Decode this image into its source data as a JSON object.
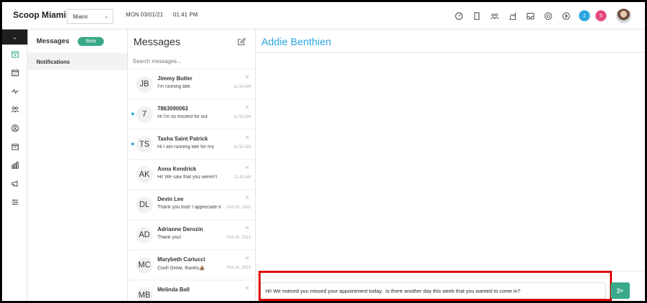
{
  "app": {
    "brand": "Scoop Miami",
    "location": "Miami",
    "date": "MON 03/01/21",
    "time": "01:41 PM"
  },
  "topbar": {
    "icons": [
      "dashboard-icon",
      "door-icon",
      "users-group-icon",
      "chart-icon",
      "inbox-icon",
      "help-icon",
      "play-icon"
    ],
    "badges": [
      {
        "value": "2",
        "color": "#2aa6df"
      },
      {
        "value": "5",
        "color": "#e54b7a"
      }
    ]
  },
  "rail": {
    "icons": [
      "add-calendar-icon",
      "calendar-icon",
      "pulse-icon",
      "users-icon",
      "user-circle-icon",
      "box-icon",
      "bar-chart-icon",
      "megaphone-icon",
      "sliders-icon"
    ]
  },
  "subnav": {
    "title": "Messages",
    "beta": "Beta",
    "items": [
      "Notifications"
    ]
  },
  "conversations": {
    "title": "Messages",
    "search_placeholder": "Search messages...",
    "items": [
      {
        "initials": "JB",
        "name": "Jimmy Butler",
        "preview": "I'm running late.",
        "stamp": "11:54 AM",
        "unread": false
      },
      {
        "initials": "7",
        "name": "7863090063",
        "preview": "Hi I'm so excited for our",
        "stamp": "11:53 AM",
        "unread": true
      },
      {
        "initials": "TS",
        "name": "Tasha Saint Patrick",
        "preview": "Hi I am running late for my",
        "stamp": "11:52 AM",
        "unread": true
      },
      {
        "initials": "AK",
        "name": "Anna Kendrick",
        "preview": "Hi! We saw that you weren't",
        "stamp": "11:42 AM",
        "unread": false
      },
      {
        "initials": "DL",
        "name": "Devin Lee",
        "preview": "Thank you bub! I appreciate it",
        "stamp": "Feb 26, 2021",
        "unread": false
      },
      {
        "initials": "AD",
        "name": "Adrianne Derozin",
        "preview": "Thank you!",
        "stamp": "Feb 25, 2021",
        "unread": false
      },
      {
        "initials": "MC",
        "name": "Marybeth Carlucci",
        "preview": "Cool! Great, thanks👍🏽",
        "stamp": "Feb 25, 2021",
        "unread": false
      },
      {
        "initials": "MB",
        "name": "Melinda Ball",
        "preview": "",
        "stamp": "",
        "unread": false
      }
    ]
  },
  "pane": {
    "contact_name": "Addie Benthien",
    "draft_message": "Hi! We noticed you missed your appointment today.  Is there another day this week that you wanted to come in?"
  },
  "colors": {
    "accent": "#3aa98a",
    "link": "#2aa6df",
    "highlight": "#e00000"
  }
}
